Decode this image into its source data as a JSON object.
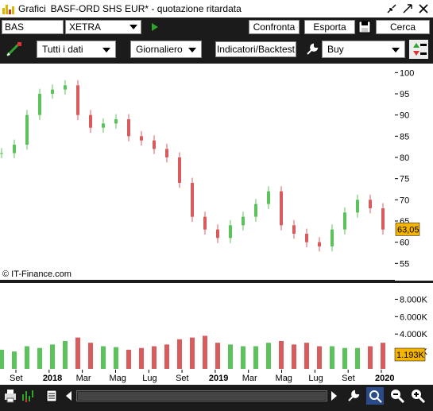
{
  "window": {
    "app_name": "Grafici",
    "title": "BASF-ORD SHS EUR* - quotazione ritardata"
  },
  "toolbar": {
    "symbol": "BAS",
    "exchange": "XETRA",
    "compare_label": "Confronta",
    "export_label": "Esporta",
    "search_label": "Cerca",
    "period_select": "Tutti i dati",
    "interval_select": "Giornaliero",
    "indicators_label": "Indicatori/Backtest",
    "order_select": "Buy"
  },
  "chart_footer": {
    "source": "© IT-Finance.com"
  },
  "colors": {
    "up": "#5cc35c",
    "down": "#d95c5c",
    "price_tag": "#f5b400",
    "background": "#ffffff",
    "toolbar": "#1b1b1b"
  },
  "chart_data": [
    {
      "type": "candlestick",
      "title": "",
      "series": [
        {
          "name": "BAS",
          "x": [
            "2017-08",
            "2017-09",
            "2017-10",
            "2017-11",
            "2017-12",
            "2018-01",
            "2018-02",
            "2018-03",
            "2018-04",
            "2018-05",
            "2018-06",
            "2018-07",
            "2018-08",
            "2018-09",
            "2018-10",
            "2018-11",
            "2018-12",
            "2019-01",
            "2019-02",
            "2019-03",
            "2019-04",
            "2019-05",
            "2019-06",
            "2019-07",
            "2019-08",
            "2019-09",
            "2019-10",
            "2019-11",
            "2019-12",
            "2020-01",
            "2020-02"
          ],
          "values": [
            81,
            83,
            90,
            95,
            96,
            97,
            90,
            87,
            88,
            89,
            85,
            84,
            82,
            80,
            74,
            66,
            63,
            61,
            64,
            66,
            69,
            72,
            64,
            62,
            60,
            59,
            63,
            67,
            70,
            68,
            63
          ]
        }
      ],
      "last_price_label": "63,05",
      "last_price": 63.05,
      "ylim": [
        53,
        101
      ],
      "y_ticks": [
        "100",
        "95",
        "90",
        "85",
        "80",
        "75",
        "70",
        "65",
        "60",
        "55"
      ],
      "grid": false
    },
    {
      "type": "bar",
      "title": "",
      "series": [
        {
          "name": "Volume",
          "values": [
            2.2,
            2.0,
            2.6,
            2.4,
            2.8,
            3.2,
            3.6,
            3.0,
            2.6,
            2.5,
            2.2,
            2.4,
            2.6,
            2.8,
            3.4,
            3.6,
            3.8,
            3.0,
            2.8,
            2.6,
            2.6,
            3.0,
            3.2,
            2.8,
            3.0,
            2.6,
            2.6,
            2.4,
            2.4,
            2.6,
            3.0
          ]
        }
      ],
      "last_volume_label": "1.193K",
      "y_ticks": [
        "8.000K",
        "6.000K",
        "4.000K",
        "2.000K"
      ],
      "x_ticks": [
        "Set",
        "2018",
        "Mar",
        "Mag",
        "Lug",
        "Set",
        "2019",
        "Mar",
        "Mag",
        "Lug",
        "Set",
        "2020"
      ]
    }
  ]
}
